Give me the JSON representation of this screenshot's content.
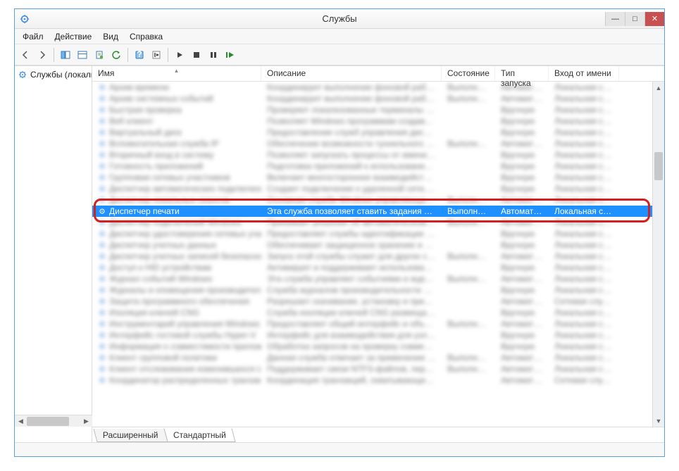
{
  "window": {
    "title": "Службы",
    "controls": {
      "min": "—",
      "max": "□",
      "close": "✕"
    }
  },
  "menubar": [
    "Файл",
    "Действие",
    "Вид",
    "Справка"
  ],
  "tree": {
    "root": "Службы (локальные)"
  },
  "columns": {
    "name": "Имя",
    "description": "Описание",
    "status": "Состояние",
    "startup": "Тип запуска",
    "logon": "Вход от имени"
  },
  "selected_row": {
    "name": "Диспетчер печати",
    "description": "Эта служба позволяет ставить задания печати в оч...",
    "status": "Выполняется",
    "startup": "Автоматиче...",
    "logon": "Локальная сис..."
  },
  "blurred_rows": [
    {
      "name": "Архив времени",
      "desc": "Координирует выполнение фоновой работы для с...",
      "stat": "Выполняется",
      "start": "Автоматиче...",
      "logon": "Локальная сис..."
    },
    {
      "name": "Архив системных событий",
      "desc": "Координирует выполнение фоновой работы для с...",
      "stat": "Выполняется",
      "start": "Автоматиче...",
      "logon": "Локальная сис..."
    },
    {
      "name": "Быстрая проверка",
      "desc": "Проверяет локализованные терминалы файлов...",
      "stat": "",
      "start": "Вручную",
      "logon": "Локальная сис..."
    },
    {
      "name": "Веб клиент",
      "desc": "Позволяет Windows программам создавать, изм...",
      "stat": "",
      "start": "Вручную",
      "logon": "Локальная сис..."
    },
    {
      "name": "Виртуальный диск",
      "desc": "Предоставление служб управления дисками, том...",
      "stat": "",
      "start": "Вручную",
      "logon": "Локальная сис..."
    },
    {
      "name": "Вспомогательная служба IP",
      "desc": "Обеспечение возможности туннельного подкл...",
      "stat": "Выполняется",
      "start": "Автоматиче...",
      "logon": "Локальная сис..."
    },
    {
      "name": "Вторичный вход в систему",
      "desc": "Позволяет запускать процессы от имени друго...",
      "stat": "",
      "start": "Вручную",
      "logon": "Локальная сис..."
    },
    {
      "name": "Готовность приложений",
      "desc": "Подготовка приложений к использованию пр...",
      "stat": "",
      "start": "Вручную",
      "logon": "Локальная сис..."
    },
    {
      "name": "Групповая сетевых участников",
      "desc": "Включает многостороннее взаимодействие с пом...",
      "stat": "",
      "start": "Вручную",
      "logon": "Локальная сис..."
    },
    {
      "name": "Диспетчер автоматических подключений уд...",
      "desc": "Создает подключение к удаленной сети, ког...",
      "stat": "",
      "start": "Вручную",
      "logon": "Локальная сис..."
    },
    {
      "name": "Диспетчер локальных сеансов",
      "desc": "Основная служба Windows управляющая лок...",
      "stat": "Выполняется",
      "start": "Автоматиче...",
      "logon": "Локальная сис..."
    },
    {
      "name": "Диспетчер подключений Windows",
      "desc": "Принимает решение об автоматическом подкл...",
      "stat": "Выполняется",
      "start": "Автоматиче...",
      "logon": "Локальная сис..."
    },
    {
      "name": "Диспетчер удостоверения сетевых участников",
      "desc": "Предоставляет службы идентификации для про...",
      "stat": "",
      "start": "Вручную",
      "logon": "Локальная сис..."
    },
    {
      "name": "Диспетчер учетных данных",
      "desc": "Обеспечивает защищенное хранение и получ...",
      "stat": "",
      "start": "Вручную",
      "logon": "Локальная сис..."
    },
    {
      "name": "Диспетчер учетных записей безопасности",
      "desc": "Запуск этой службы служит для других служб сиг...",
      "stat": "Выполняется",
      "start": "Автоматиче...",
      "logon": "Локальная сис..."
    },
    {
      "name": "Доступ к HID устройствам",
      "desc": "Активирует и поддерживает использование кн...",
      "stat": "",
      "start": "Вручную",
      "logon": "Локальная сис..."
    },
    {
      "name": "Журнал событий Windows",
      "desc": "Эта служба управляет событиями и журналами соб...",
      "stat": "Выполняется",
      "start": "Автоматиче...",
      "logon": "Локальная сис..."
    },
    {
      "name": "Журналы и оповещения производительности",
      "desc": "Служба журналов производительности и опове...",
      "stat": "",
      "start": "Вручную",
      "logon": "Локальная сис..."
    },
    {
      "name": "Защита программного обеспечения",
      "desc": "Разрешает скачивание, установку и принудитель...",
      "stat": "",
      "start": "Автоматиче...",
      "logon": "Сетевая служб..."
    },
    {
      "name": "Изоляция ключей CNG",
      "desc": "Служба изоляции ключей CNG размещается в...",
      "stat": "",
      "start": "Вручную",
      "logon": "Локальная сис..."
    },
    {
      "name": "Инструментарий управления Windows",
      "desc": "Предоставляет общий интерфейс и объектную м...",
      "stat": "Выполняется",
      "start": "Автоматиче...",
      "logon": "Локальная сис..."
    },
    {
      "name": "Интерфейс гостевой службы Hyper-V",
      "desc": "Интерфейс для взаимодействия для узла Hyper-V...",
      "stat": "",
      "start": "Вручную",
      "logon": "Локальная сис..."
    },
    {
      "name": "Информация о совместимости приложений",
      "desc": "Обработка запросов на проверку совместимос...",
      "stat": "",
      "start": "Вручную",
      "logon": "Локальная сис..."
    },
    {
      "name": "Клиент групповой политики",
      "desc": "Данная служба отвечает за применение парам...",
      "stat": "Выполняется",
      "start": "Автоматиче...",
      "logon": "Локальная сис..."
    },
    {
      "name": "Клиент отслеживания изменившихся связей",
      "desc": "Поддерживает связи NTFS-файлов, перемещаем...",
      "stat": "Выполняется",
      "start": "Автоматиче...",
      "logon": "Локальная сис..."
    },
    {
      "name": "Координатор распределенных транзакций",
      "desc": "Координация транзакций, охватывающих неско...",
      "stat": "",
      "start": "Автоматиче...",
      "logon": "Сетевая служб..."
    }
  ],
  "tabs": {
    "extended": "Расширенный",
    "standard": "Стандартный"
  }
}
